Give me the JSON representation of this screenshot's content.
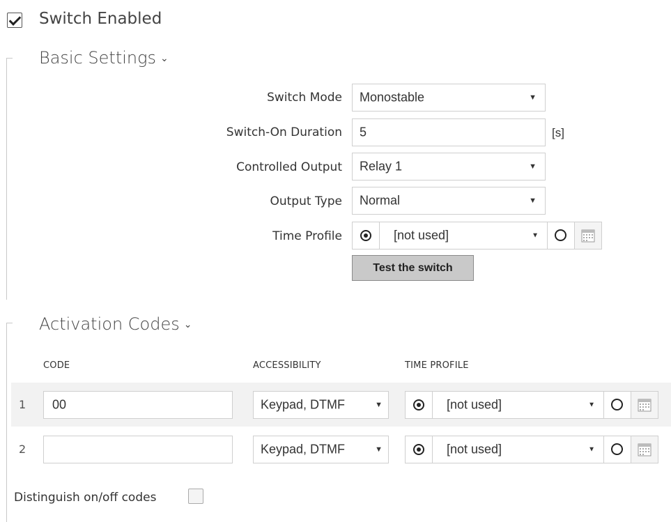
{
  "switch_enabled": {
    "label": "Switch Enabled",
    "checked": true
  },
  "basic_settings": {
    "title": "Basic Settings",
    "switch_mode": {
      "label": "Switch Mode",
      "value": "Monostable"
    },
    "switch_on_duration": {
      "label": "Switch-On Duration",
      "value": "5",
      "unit": "[s]"
    },
    "controlled_output": {
      "label": "Controlled Output",
      "value": "Relay 1"
    },
    "output_type": {
      "label": "Output Type",
      "value": "Normal"
    },
    "time_profile": {
      "label": "Time Profile",
      "value": "[not used]"
    },
    "test_button": "Test the switch"
  },
  "activation_codes": {
    "title": "Activation Codes",
    "columns": [
      "CODE",
      "ACCESSIBILITY",
      "TIME PROFILE"
    ],
    "rows": [
      {
        "num": "1",
        "code": "00",
        "accessibility": "Keypad, DTMF",
        "time_profile": "[not used]"
      },
      {
        "num": "2",
        "code": "",
        "accessibility": "Keypad, DTMF",
        "time_profile": "[not used]"
      }
    ]
  },
  "distinguish": {
    "label": "Distinguish on/off codes",
    "checked": false
  },
  "icons": {
    "chevron": "chevron-down-icon",
    "calendar": "calendar-icon",
    "dropdown": "dropdown-arrow-icon"
  },
  "colors": {
    "row_highlight": "#f2f2f2",
    "button_bg": "#c9c9c9",
    "border": "#cfcfcf"
  }
}
